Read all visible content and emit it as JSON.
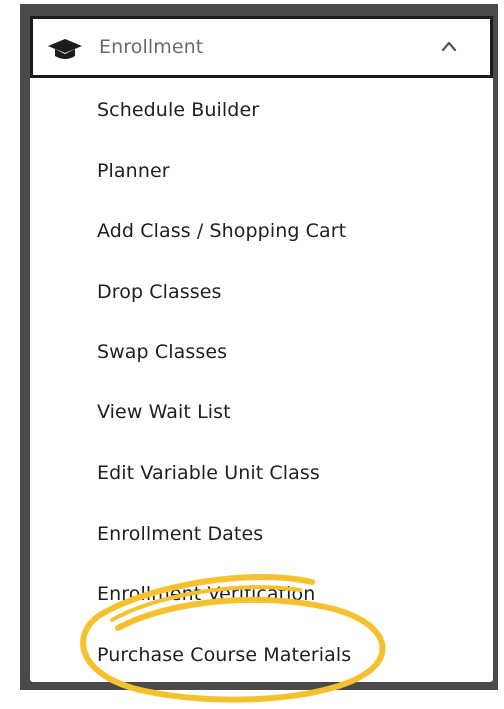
{
  "menu": {
    "header": {
      "title": "Enrollment",
      "icon": "graduation-cap-icon",
      "chevron": "chevron-up-icon"
    },
    "items": [
      {
        "label": "Schedule Builder"
      },
      {
        "label": "Planner"
      },
      {
        "label": "Add Class / Shopping Cart"
      },
      {
        "label": "Drop Classes"
      },
      {
        "label": "Swap Classes"
      },
      {
        "label": "View Wait List"
      },
      {
        "label": "Edit Variable Unit Class"
      },
      {
        "label": "Enrollment Dates"
      },
      {
        "label": "Enrollment Verification"
      },
      {
        "label": "Purchase Course Materials"
      }
    ]
  },
  "colors": {
    "frame": "#4a4a4a",
    "header_border": "#1c1c1c",
    "header_text": "#6a6a6a",
    "item_text": "#1f1f1f",
    "highlight": "#f6c12e"
  }
}
